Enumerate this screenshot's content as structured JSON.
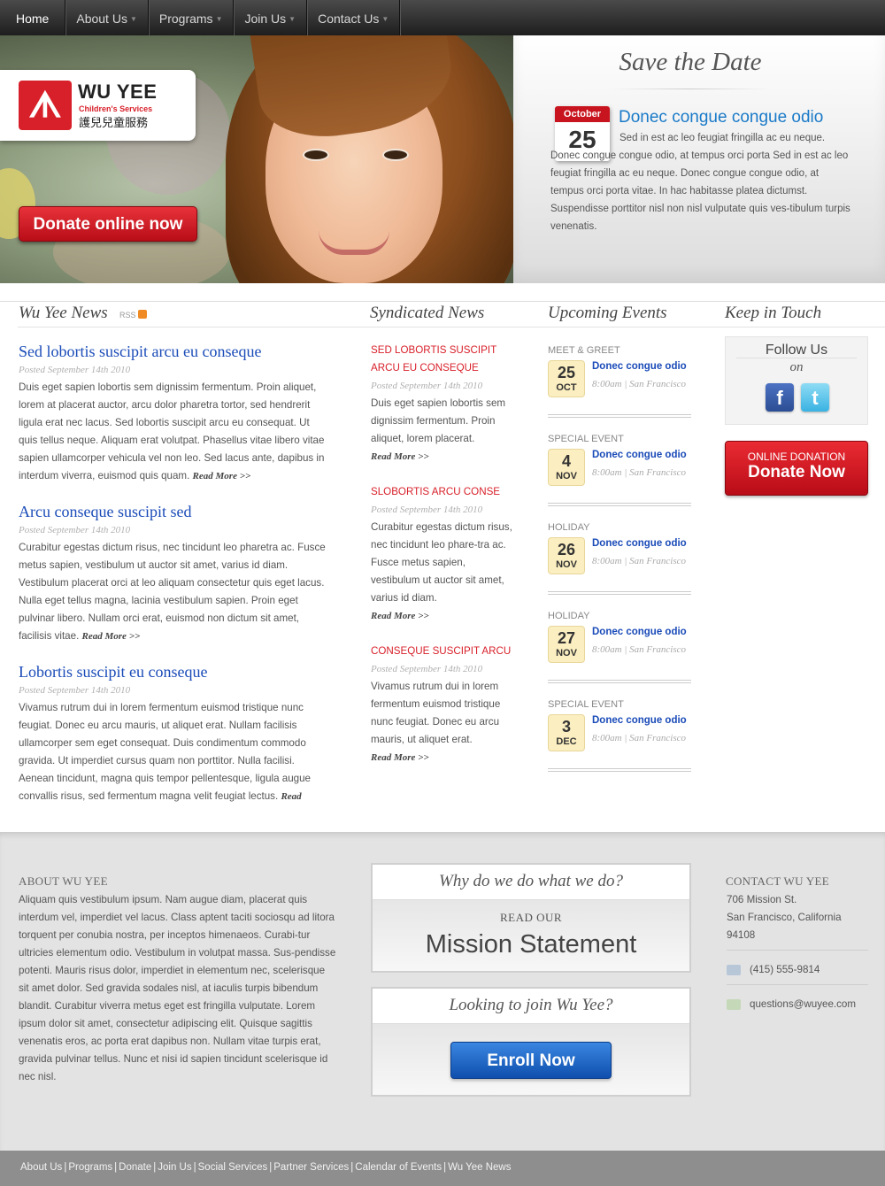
{
  "nav": {
    "items": [
      {
        "label": "Home",
        "active": true,
        "dropdown": false
      },
      {
        "label": "About Us",
        "dropdown": true
      },
      {
        "label": "Programs",
        "dropdown": true
      },
      {
        "label": "Join Us",
        "dropdown": true
      },
      {
        "label": "Contact Us",
        "dropdown": true
      }
    ]
  },
  "logo": {
    "title": "WU YEE",
    "subtitle": "Children's Services",
    "chinese": "護兒兒童服務"
  },
  "hero": {
    "donate_label": "Donate online now"
  },
  "save_the_date": {
    "title": "Save the Date",
    "month": "October",
    "day": "25",
    "heading": "Donec congue congue odio",
    "text": "Sed in est ac leo feugiat fringilla ac eu neque. Donec congue congue odio, at tempus orci porta Sed in est ac leo feugiat fringilla ac eu neque. Donec congue congue odio, at tempus orci porta vitae. In hac habitasse platea dictumst. Suspendisse porttitor nisl non nisl vulputate quis ves-tibulum turpis venenatis."
  },
  "columns": {
    "news": "Wu Yee News",
    "rss": "RSS",
    "syndicated": "Syndicated News",
    "events": "Upcoming Events",
    "touch": "Keep in Touch"
  },
  "news": [
    {
      "title": "Sed lobortis suscipit arcu eu conseque",
      "posted": "Posted September 14th 2010",
      "body": "Duis eget sapien lobortis sem dignissim fermentum. Proin aliquet, lorem at placerat auctor, arcu dolor pharetra tortor, sed hendrerit ligula erat nec lacus. Sed lobortis suscipit arcu eu consequat. Ut quis tellus neque. Aliquam erat volutpat. Phasellus vitae libero vitae sapien ullamcorper vehicula vel non leo. Sed lacus ante, dapibus in interdum viverra, euismod quis quam.",
      "more": "Read More >>"
    },
    {
      "title": "Arcu conseque suscipit sed",
      "posted": "Posted September 14th 2010",
      "body": "Curabitur egestas dictum risus, nec tincidunt leo pharetra ac. Fusce metus sapien, vestibulum ut auctor sit amet, varius id diam. Vestibulum placerat orci at leo aliquam consectetur quis eget lacus. Nulla eget tellus magna, lacinia vestibulum sapien. Proin eget pulvinar libero. Nullam orci erat, euismod non dictum sit amet, facilisis vitae.",
      "more": "Read More >>"
    },
    {
      "title": "Lobortis suscipit eu conseque",
      "posted": "Posted September 14th 2010",
      "body": "Vivamus rutrum dui in lorem fermentum euismod tristique nunc feugiat. Donec eu arcu mauris, ut aliquet erat. Nullam facilisis ullamcorper sem eget consequat. Duis condimentum commodo gravida. Ut imperdiet cursus quam non porttitor. Nulla facilisi. Aenean tincidunt, magna quis tempor pellentesque, ligula augue convallis risus, sed fermentum magna velit feugiat lectus.",
      "more": "Read"
    }
  ],
  "syndicated": [
    {
      "title": "SED LOBORTIS SUSCIPIT ARCU EU CONSEQUE",
      "posted": "Posted September 14th 2010",
      "body": "Duis eget sapien lobortis sem dignissim fermentum. Proin aliquet, lorem placerat.",
      "more": "Read More >>"
    },
    {
      "title": "SLOBORTIS ARCU CONSE",
      "posted": "Posted September 14th 2010",
      "body": "Curabitur egestas dictum risus, nec tincidunt leo phare-tra ac. Fusce metus sapien, vestibulum ut auctor sit amet, varius id diam.",
      "more": "Read More >>"
    },
    {
      "title": "CONSEQUE SUSCIPIT ARCU",
      "posted": "Posted September 14th 2010",
      "body": "Vivamus rutrum dui in lorem fermentum euismod tristique nunc feugiat. Donec eu arcu mauris, ut aliquet erat.",
      "more": "Read More >>"
    }
  ],
  "events": [
    {
      "type": "MEET & GREET",
      "day": "25",
      "month": "OCT",
      "name": "Donec congue odio",
      "time": "8:00am",
      "place": "San Francisco"
    },
    {
      "type": "SPECIAL EVENT",
      "day": "4",
      "month": "NOV",
      "name": "Donec congue odio",
      "time": "8:00am",
      "place": "San Francisco"
    },
    {
      "type": "HOLIDAY",
      "day": "26",
      "month": "NOV",
      "name": "Donec congue odio",
      "time": "8:00am",
      "place": "San Francisco"
    },
    {
      "type": "HOLIDAY",
      "day": "27",
      "month": "NOV",
      "name": "Donec congue odio",
      "time": "8:00am",
      "place": "San Francisco"
    },
    {
      "type": "SPECIAL EVENT",
      "day": "3",
      "month": "DEC",
      "name": "Donec congue odio",
      "time": "8:00am",
      "place": "San Francisco"
    }
  ],
  "touch": {
    "follow": "Follow Us",
    "on": "on",
    "facebook_icon": "facebook-icon",
    "twitter_icon": "twitter-icon",
    "donation_small": "ONLINE DONATION",
    "donation_big": "Donate Now"
  },
  "footer": {
    "about_head": "ABOUT WU YEE",
    "about_text": "Aliquam quis vestibulum ipsum. Nam augue diam, placerat quis interdum vel, imperdiet vel lacus. Class aptent taciti sociosqu ad litora torquent per conubia nostra, per inceptos himenaeos. Curabi-tur ultricies elementum odio. Vestibulum in volutpat massa. Sus-pendisse potenti. Mauris risus dolor, imperdiet in elementum nec, scelerisque sit amet dolor. Sed gravida sodales nisl, at iaculis turpis bibendum blandit. Curabitur viverra metus eget est fringilla vulputate. Lorem ipsum dolor sit amet, consectetur adipiscing elit. Quisque sagittis venenatis eros, ac porta erat dapibus non. Nullam vitae turpis erat, gravida pulvinar tellus. Nunc et nisi id sapien tincidunt scelerisque id nec nisl.",
    "why_title": "Why do we do what we do?",
    "read_our": "READ OUR",
    "mission": "Mission Statement",
    "join_title": "Looking to join Wu Yee?",
    "enroll": "Enroll Now",
    "contact_head": "CONTACT WU YEE",
    "address1": "706 Mission St.",
    "address2": "San Francisco, California",
    "zip": "94108",
    "phone": "(415) 555-9814",
    "email": "questions@wuyee.com"
  },
  "bottom_links": [
    "About Us",
    "Programs",
    "Donate",
    "Join Us",
    "Social Services",
    "Partner Services",
    "Calendar of Events",
    "Wu Yee News"
  ]
}
